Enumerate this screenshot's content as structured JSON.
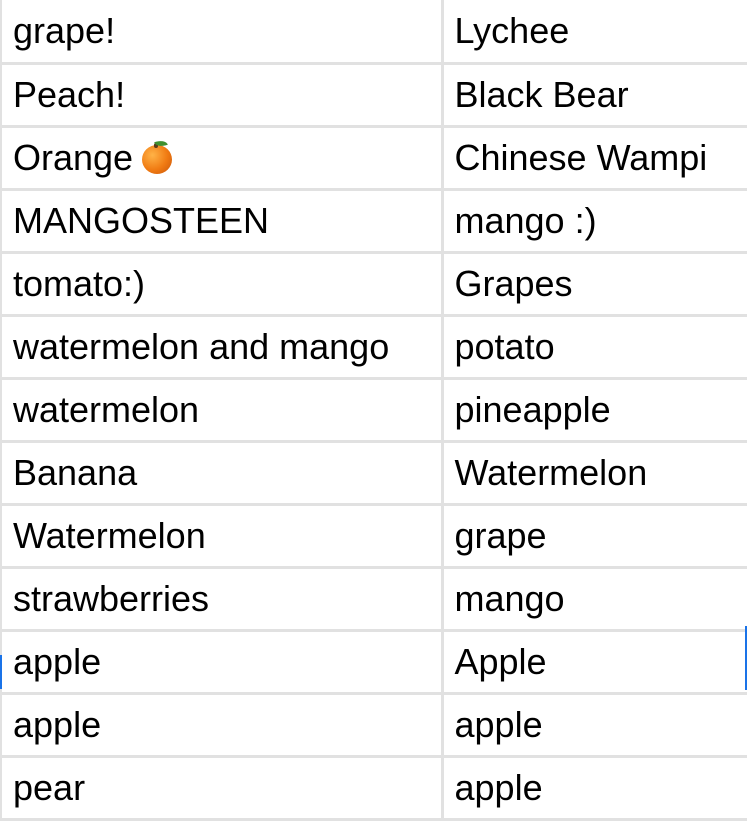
{
  "table": {
    "rows": [
      {
        "a": "grape!",
        "b": "Lychee"
      },
      {
        "a": "Peach!",
        "b": "Black Bear"
      },
      {
        "a": "Orange",
        "a_icon": "tangerine-emoji-icon",
        "b": "Chinese Wampi"
      },
      {
        "a": "MANGOSTEEN",
        "b": "mango :)"
      },
      {
        "a": "tomato:)",
        "b": "Grapes"
      },
      {
        "a": "watermelon and mango",
        "b": "potato"
      },
      {
        "a": "watermelon",
        "b": "pineapple"
      },
      {
        "a": "Banana",
        "b": "Watermelon"
      },
      {
        "a": "Watermelon",
        "b": "grape"
      },
      {
        "a": "strawberries",
        "b": "mango"
      },
      {
        "a": "apple",
        "b": "Apple"
      },
      {
        "a": "apple",
        "b": "apple"
      },
      {
        "a": "pear",
        "b": "apple"
      }
    ]
  },
  "colors": {
    "gridline": "#e1e1e1",
    "selection": "#1a73e8",
    "text": "#000000"
  }
}
